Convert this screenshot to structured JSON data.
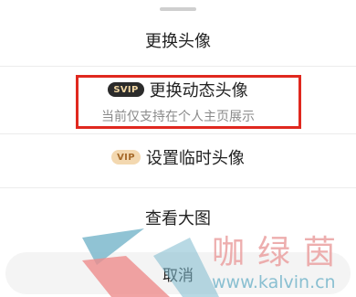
{
  "sheet": {
    "title": "更换头像",
    "svip_item": {
      "badge": "SVIP",
      "label": "更换动态头像",
      "subtitle": "当前仅支持在个人主页展示"
    },
    "vip_item": {
      "badge": "VIP",
      "label": "设置临时头像"
    },
    "view_item": {
      "label": "查看大图"
    },
    "cancel_label": "取消"
  },
  "watermark": {
    "text": "咖绿茵",
    "url": "www.kalvin.cn"
  },
  "colors": {
    "highlight": "#e0281f",
    "svip_badge_bg": "#2b2b2b",
    "vip_badge_bg": "#f3d8b0"
  }
}
